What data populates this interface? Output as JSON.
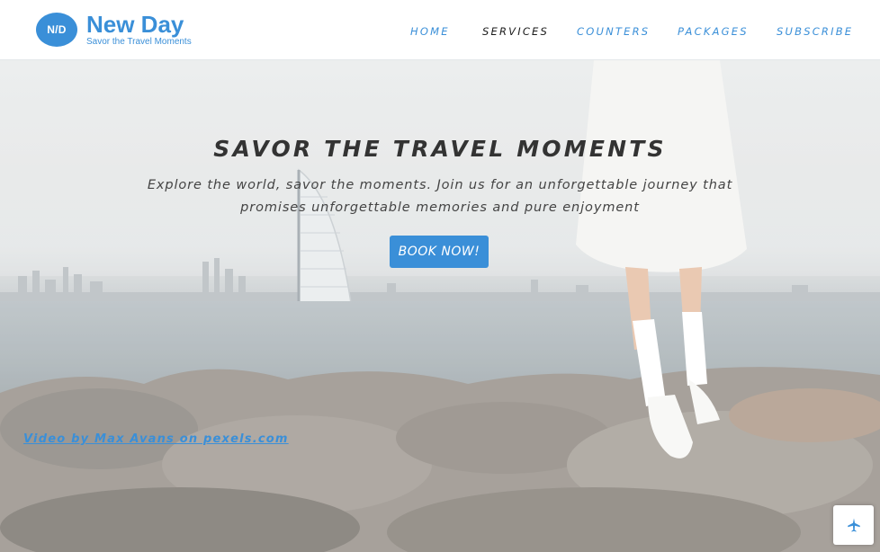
{
  "brand": {
    "badge": "N/D",
    "name": "New Day",
    "tagline": "Savor the Travel Moments",
    "accent_color": "#3a8fd8"
  },
  "nav": {
    "items": [
      {
        "label": "HOME",
        "active": false
      },
      {
        "label": "SERVICES",
        "active": true
      },
      {
        "label": "COUNTERS",
        "active": false
      },
      {
        "label": "PACKAGES",
        "active": false
      },
      {
        "label": "SUBSCRIBE",
        "active": false
      }
    ]
  },
  "hero": {
    "title": "SAVOR THE TRAVEL MOMENTS",
    "subtitle": "Explore the world, savor the moments. Join us for an unforgettable journey that promises unforgettable memories and pure enjoyment",
    "cta_label": "BOOK NOW!",
    "credit": "Video by Max Avans on pexels.com"
  },
  "scroll_top": {
    "icon": "airplane-icon"
  }
}
